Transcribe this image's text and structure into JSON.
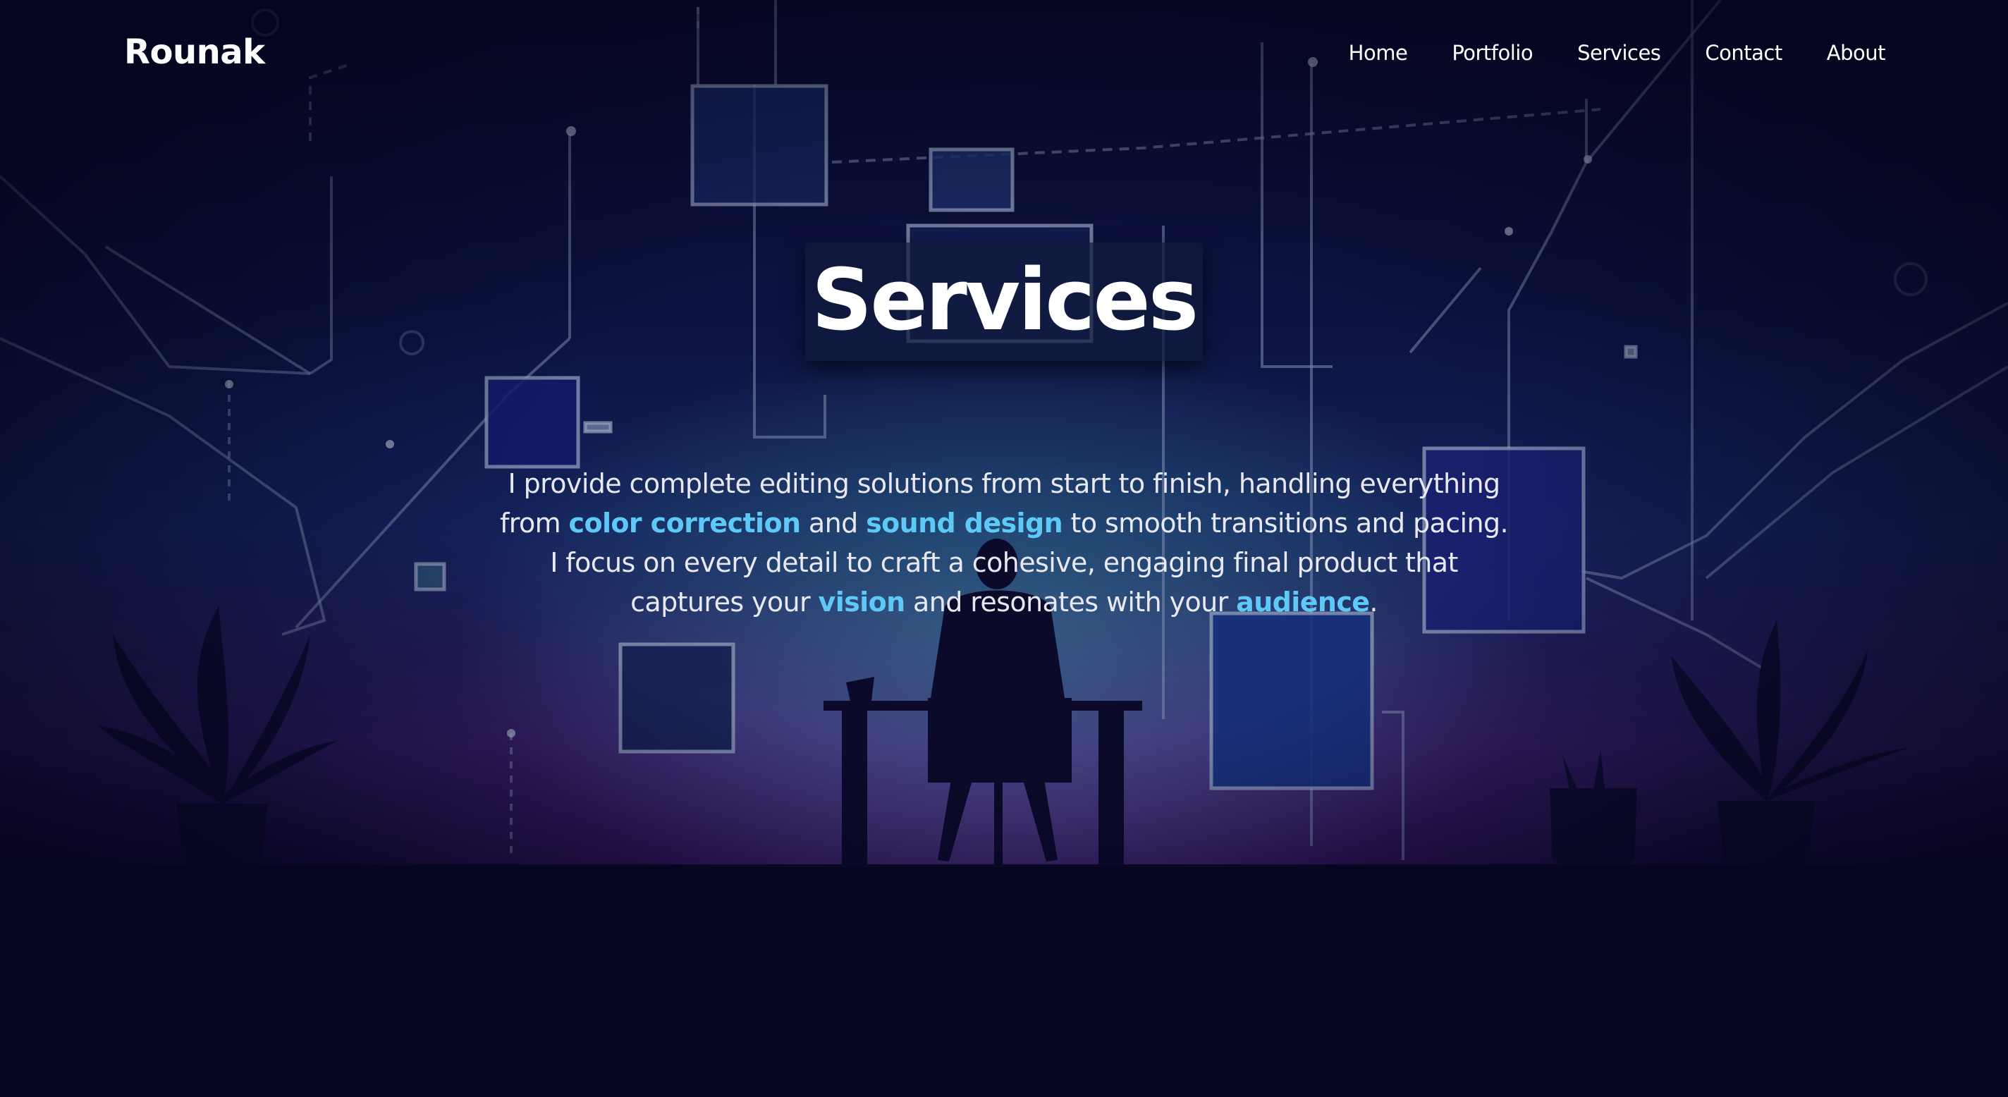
{
  "brand": {
    "name": "Rounak"
  },
  "nav": {
    "items": [
      {
        "label": "Home"
      },
      {
        "label": "Portfolio"
      },
      {
        "label": "Services"
      },
      {
        "label": "Contact"
      },
      {
        "label": "About"
      }
    ]
  },
  "hero": {
    "title": "Services",
    "paragraph": {
      "p1": "I provide complete editing solutions from start to finish, handling everything from ",
      "h1": "color correction",
      "p2": " and ",
      "h2": "sound design",
      "p3": " to smooth transitions and pacing. I focus on every detail to craft a cohesive, engaging final product that captures your ",
      "h3": "vision",
      "p4": " and resonates with your ",
      "h4": "audience",
      "p5": "."
    }
  },
  "colors": {
    "highlight": "#5ec8f6",
    "background": "#05051f"
  }
}
